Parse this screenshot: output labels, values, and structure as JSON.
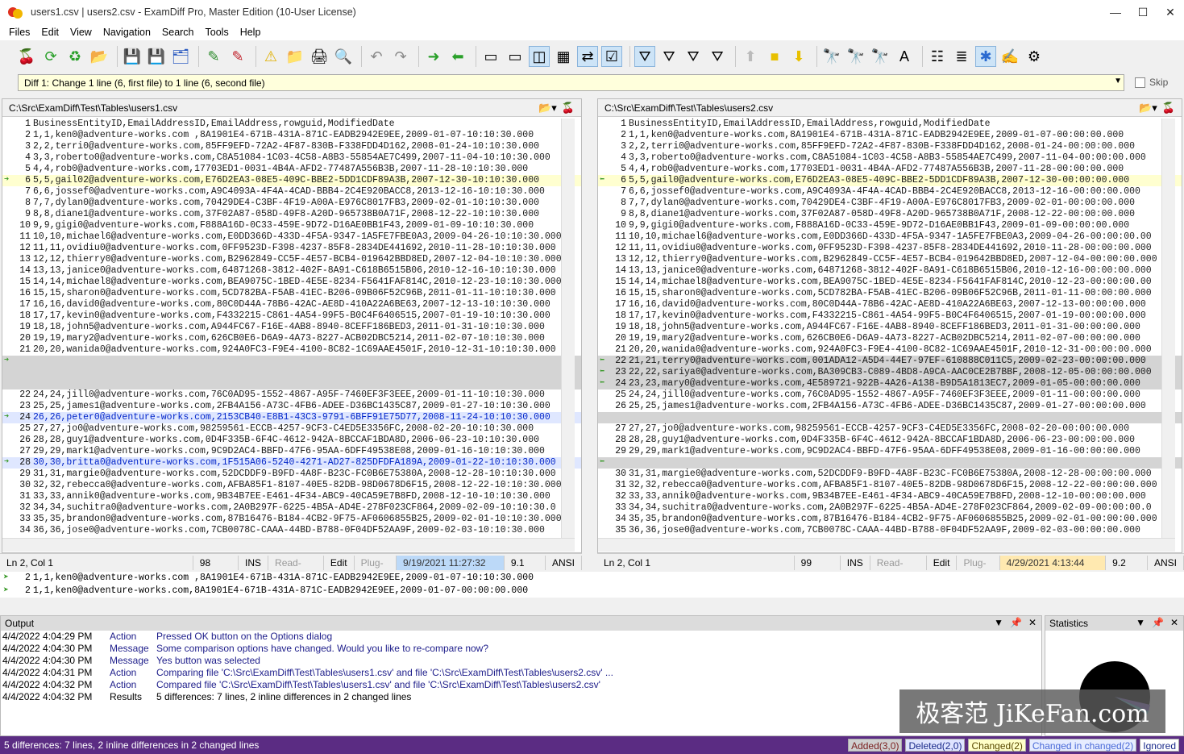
{
  "title": "users1.csv  |  users2.csv - ExamDiff Pro, Master Edition (10-User License)",
  "menu": [
    "Files",
    "Edit",
    "View",
    "Navigation",
    "Search",
    "Tools",
    "Help"
  ],
  "toolbar": [
    "open-icon",
    "refresh-icon",
    "recompare-icon",
    "open-folder-icon",
    "save-icon",
    "save-as-icon",
    "save-all-icon",
    "edit-left-icon",
    "edit-right-icon",
    "warning-icon",
    "folder-warning-icon",
    "print-icon",
    "print-preview-icon",
    "undo-icon",
    "redo-icon",
    "next-diff-icon",
    "prev-diff-icon",
    "single-pane-icon",
    "two-pane-icon",
    "side-by-side-icon",
    "grid-icon",
    "sync-icon",
    "check-icon",
    "filter-icon",
    "filter2-icon",
    "filter3-icon",
    "filter4-icon",
    "up-icon",
    "square-icon",
    "down-icon",
    "find-icon",
    "find-next-icon",
    "find-prev-icon",
    "case-icon",
    "options-icon",
    "lines-icon",
    "plugin-icon",
    "notes-icon",
    "gear-icon"
  ],
  "diff_selector": "Diff 1: Change 1 line (6, first file) to 1 line (6, second file)",
  "skip_label": "Skip",
  "left": {
    "path": "C:\\Src\\ExamDiff\\Test\\Tables\\users1.csv",
    "lines": [
      [
        "1",
        "BusinessEntityID,EmailAddressID,EmailAddress,rowguid,ModifiedDate",
        ""
      ],
      [
        "2",
        "1,1,ken0@adventure-works.com ,8A1901E4-671B-431A-871C-EADB2942E9EE,2009-01-07-10:10:30.000",
        ""
      ],
      [
        "3",
        "2,2,terri0@adventure-works.com,85FF9EFD-72A2-4F87-830B-F338FDD4D162,2008-01-24-10:10:30.000",
        ""
      ],
      [
        "4",
        "3,3,roberto0@adventure-works.com,C8A51084-1C03-4C58-A8B3-55854AE7C499,2007-11-04-10:10:30.000",
        ""
      ],
      [
        "5",
        "4,4,rob0@adventure-works.com,17703ED1-0031-4B4A-AFD2-77487A556B3B,2007-11-28-10:10:30.000",
        ""
      ],
      [
        "6",
        "5,5,gail02@adventure-works.com,E76D2EA3-08E5-409C-BBE2-5DD1CDF89A3B,2007-12-30-10:10:30.000",
        "chg"
      ],
      [
        "7",
        "6,6,jossef0@adventure-works.com,A9C4093A-4F4A-4CAD-BBB4-2C4E920BACC8,2013-12-16-10:10:30.000",
        ""
      ],
      [
        "8",
        "7,7,dylan0@adventure-works.com,70429DE4-C3BF-4F19-A00A-E976C8017FB3,2009-02-01-10:10:30.000",
        ""
      ],
      [
        "9",
        "8,8,diane1@adventure-works.com,37F02A87-058D-49F8-A20D-965738B0A71F,2008-12-22-10:10:30.000",
        ""
      ],
      [
        "10",
        "9,9,gigi0@adventure-works.com,F888A16D-0C33-459E-9D72-D16AE0BB1F43,2009-01-09-10:10:30.000",
        ""
      ],
      [
        "11",
        "10,10,michael6@adventure-works.com,E0DD366D-433D-4F5A-9347-1A5FE7FBE0A3,2009-04-26-10:10:30.000",
        ""
      ],
      [
        "12",
        "11,11,ovidiu0@adventure-works.com,0FF9523D-F398-4237-85F8-2834DE441692,2010-11-28-10:10:30.000",
        ""
      ],
      [
        "13",
        "12,12,thierry0@adventure-works.com,B2962849-CC5F-4E57-BCB4-019642BBD8ED,2007-12-04-10:10:30.000",
        ""
      ],
      [
        "14",
        "13,13,janice0@adventure-works.com,64871268-3812-402F-8A91-C618B6515B06,2010-12-16-10:10:30.000",
        ""
      ],
      [
        "15",
        "14,14,michael8@adventure-works.com,BEA9075C-1BED-4E5E-8234-F5641FAF814C,2010-12-23-10:10:30.000",
        ""
      ],
      [
        "16",
        "15,15,sharon0@adventure-works.com,5CD782BA-F5AB-41EC-B206-09B06F52C96B,2011-01-11-10:10:30.000",
        ""
      ],
      [
        "17",
        "16,16,david0@adventure-works.com,80C0D44A-78B6-42AC-AE8D-410A22A6BE63,2007-12-13-10:10:30.000",
        ""
      ],
      [
        "18",
        "17,17,kevin0@adventure-works.com,F4332215-C861-4A54-99F5-B0C4F6406515,2007-01-19-10:10:30.000",
        ""
      ],
      [
        "19",
        "18,18,john5@adventure-works.com,A944FC67-F16E-4AB8-8940-8CEFF186BED3,2011-01-31-10:10:30.000",
        ""
      ],
      [
        "20",
        "19,19,mary2@adventure-works.com,626CB0E6-D6A9-4A73-8227-ACB02DBC5214,2011-02-07-10:10:30.000",
        ""
      ],
      [
        "21",
        "20,20,wanida0@adventure-works.com,924A0FC3-F9E4-4100-8C82-1C69AAE4501F,2010-12-31-10:10:30.000",
        ""
      ],
      [
        "",
        "",
        "blk"
      ],
      [
        "",
        "",
        "blk"
      ],
      [
        "",
        "",
        "blk"
      ],
      [
        "22",
        "24,24,jill0@adventure-works.com,76C0AD95-1552-4867-A95F-7460EF3F3EEE,2009-01-11-10:10:30.000",
        ""
      ],
      [
        "23",
        "25,25,james1@adventure-works.com,2FB4A156-A73C-4FB6-ADEE-D36BC1435C87,2009-01-27-10:10:30.000",
        ""
      ],
      [
        "24",
        "26,26,peter0@adventure-works.com,2153CB40-E8B1-43C3-9791-6BFF91E75D77,2008-11-24-10:10:30.000",
        "inl"
      ],
      [
        "25",
        "27,27,jo0@adventure-works.com,98259561-ECCB-4257-9CF3-C4ED5E3356FC,2008-02-20-10:10:30.000",
        ""
      ],
      [
        "26",
        "28,28,guy1@adventure-works.com,0D4F335B-6F4C-4612-942A-8BCCAF1BDA8D,2006-06-23-10:10:30.000",
        ""
      ],
      [
        "27",
        "29,29,mark1@adventure-works.com,9C9D2AC4-BBFD-47F6-95AA-6DFF49538E08,2009-01-16-10:10:30.000",
        ""
      ],
      [
        "28",
        "30,30,britta0@adventure-works.com,1F515A06-5240-4271-AD27-825DFDFA189A,2009-01-22-10:10:30.000",
        "inl"
      ],
      [
        "29",
        "31,31,margie0@adventure-works.com,52DCDDF9-B9FD-4A8F-B23C-FC0B6E75380A,2008-12-28-10:10:30.000",
        ""
      ],
      [
        "30",
        "32,32,rebecca0@adventure-works.com,AFBA85F1-8107-40E5-82DB-98D0678D6F15,2008-12-22-10:10:30.000",
        ""
      ],
      [
        "31",
        "33,33,annik0@adventure-works.com,9B34B7EE-E461-4F34-ABC9-40CA59E7B8FD,2008-12-10-10:10:30.000",
        ""
      ],
      [
        "32",
        "34,34,suchitra0@adventure-works.com,2A0B297F-6225-4B5A-AD4E-278F023CF864,2009-02-09-10:10:30.0",
        ""
      ],
      [
        "33",
        "35,35,brandon0@adventure-works.com,87B16476-B184-4CB2-9F75-AF0606855B25,2009-02-01-10:10:30.000",
        ""
      ],
      [
        "34",
        "36,36,jose0@adventure-works.com,7CB0078C-CAAA-44BD-B788-0F04DF52AA9F,2009-02-03-10:10:30.000",
        ""
      ]
    ],
    "status": {
      "pos": "Ln 2, Col 1",
      "lines": "98 lines",
      "ins": "INS",
      "ro": "Read-only",
      "edit": "Edit",
      "plugin": "Plug-in",
      "date": "9/19/2021 11:27:32 AM",
      "size": "9.1 KB",
      "enc": "ANSI"
    }
  },
  "right": {
    "path": "C:\\Src\\ExamDiff\\Test\\Tables\\users2.csv",
    "lines": [
      [
        "1",
        "BusinessEntityID,EmailAddressID,EmailAddress,rowguid,ModifiedDate",
        ""
      ],
      [
        "2",
        "1,1,ken0@adventure-works.com,8A1901E4-671B-431A-871C-EADB2942E9EE,2009-01-07-00:00:00.000",
        ""
      ],
      [
        "3",
        "2,2,terri0@adventure-works.com,85FF9EFD-72A2-4F87-830B-F338FDD4D162,2008-01-24-00:00:00.000",
        ""
      ],
      [
        "4",
        "3,3,roberto0@adventure-works.com,C8A51084-1C03-4C58-A8B3-55854AE7C499,2007-11-04-00:00:00.000",
        ""
      ],
      [
        "5",
        "4,4,rob0@adventure-works.com,17703ED1-0031-4B4A-AFD2-77487A556B3B,2007-11-28-00:00:00.000",
        ""
      ],
      [
        "6",
        "5,5,gail0@adventure-works.com,E76D2EA3-08E5-409C-BBE2-5DD1CDF89A3B,2007-12-30-00:00:00.000",
        "chg"
      ],
      [
        "7",
        "6,6,jossef0@adventure-works.com,A9C4093A-4F4A-4CAD-BBB4-2C4E920BACC8,2013-12-16-00:00:00.000",
        ""
      ],
      [
        "8",
        "7,7,dylan0@adventure-works.com,70429DE4-C3BF-4F19-A00A-E976C8017FB3,2009-02-01-00:00:00.000",
        ""
      ],
      [
        "9",
        "8,8,diane1@adventure-works.com,37F02A87-058D-49F8-A20D-965738B0A71F,2008-12-22-00:00:00.000",
        ""
      ],
      [
        "10",
        "9,9,gigi0@adventure-works.com,F888A16D-0C33-459E-9D72-D16AE0BB1F43,2009-01-09-00:00:00.000",
        ""
      ],
      [
        "11",
        "10,10,michael6@adventure-works.com,E0DD366D-433D-4F5A-9347-1A5FE7FBE0A3,2009-04-26-00:00:00.00",
        ""
      ],
      [
        "12",
        "11,11,ovidiu0@adventure-works.com,0FF9523D-F398-4237-85F8-2834DE441692,2010-11-28-00:00:00.000",
        ""
      ],
      [
        "13",
        "12,12,thierry0@adventure-works.com,B2962849-CC5F-4E57-BCB4-019642BBD8ED,2007-12-04-00:00:00.000",
        ""
      ],
      [
        "14",
        "13,13,janice0@adventure-works.com,64871268-3812-402F-8A91-C618B6515B06,2010-12-16-00:00:00.000",
        ""
      ],
      [
        "15",
        "14,14,michael8@adventure-works.com,BEA9075C-1BED-4E5E-8234-F5641FAF814C,2010-12-23-00:00:00.00",
        ""
      ],
      [
        "16",
        "15,15,sharon0@adventure-works.com,5CD782BA-F5AB-41EC-B206-09B06F52C96B,2011-01-11-00:00:00.000",
        ""
      ],
      [
        "17",
        "16,16,david0@adventure-works.com,80C0D44A-78B6-42AC-AE8D-410A22A6BE63,2007-12-13-00:00:00.000",
        ""
      ],
      [
        "18",
        "17,17,kevin0@adventure-works.com,F4332215-C861-4A54-99F5-B0C4F6406515,2007-01-19-00:00:00.000",
        ""
      ],
      [
        "19",
        "18,18,john5@adventure-works.com,A944FC67-F16E-4AB8-8940-8CEFF186BED3,2011-01-31-00:00:00.000",
        ""
      ],
      [
        "20",
        "19,19,mary2@adventure-works.com,626CB0E6-D6A9-4A73-8227-ACB02DBC5214,2011-02-07-00:00:00.000",
        ""
      ],
      [
        "21",
        "20,20,wanida0@adventure-works.com,924A0FC3-F9E4-4100-8C82-1C69AAE4501F,2010-12-31-00:00:00.000",
        ""
      ],
      [
        "22",
        "21,21,terry0@adventure-works.com,001ADA12-A5D4-44E7-97EF-610888C011C5,2009-02-23-00:00:00.000",
        "ins"
      ],
      [
        "23",
        "22,22,sariya0@adventure-works.com,BA309CB3-C089-4BD8-A9CA-AAC0CE2B7BBF,2008-12-05-00:00:00.000",
        "ins"
      ],
      [
        "24",
        "23,23,mary0@adventure-works.com,4E589721-922B-4A26-A138-B9D5A1813EC7,2009-01-05-00:00:00.000",
        "ins"
      ],
      [
        "25",
        "24,24,jill0@adventure-works.com,76C0AD95-1552-4867-A95F-7460EF3F3EEE,2009-01-11-00:00:00.000",
        ""
      ],
      [
        "26",
        "25,25,james1@adventure-works.com,2FB4A156-A73C-4FB6-ADEE-D36BC1435C87,2009-01-27-00:00:00.000",
        ""
      ],
      [
        "",
        "",
        "blk"
      ],
      [
        "27",
        "27,27,jo0@adventure-works.com,98259561-ECCB-4257-9CF3-C4ED5E3356FC,2008-02-20-00:00:00.000",
        ""
      ],
      [
        "28",
        "28,28,guy1@adventure-works.com,0D4F335B-6F4C-4612-942A-8BCCAF1BDA8D,2006-06-23-00:00:00.000",
        ""
      ],
      [
        "29",
        "29,29,mark1@adventure-works.com,9C9D2AC4-BBFD-47F6-95AA-6DFF49538E08,2009-01-16-00:00:00.000",
        ""
      ],
      [
        "",
        "",
        "blk"
      ],
      [
        "30",
        "31,31,margie0@adventure-works.com,52DCDDF9-B9FD-4A8F-B23C-FC0B6E75380A,2008-12-28-00:00:00.000",
        ""
      ],
      [
        "31",
        "32,32,rebecca0@adventure-works.com,AFBA85F1-8107-40E5-82DB-98D0678D6F15,2008-12-22-00:00:00.000",
        ""
      ],
      [
        "32",
        "33,33,annik0@adventure-works.com,9B34B7EE-E461-4F34-ABC9-40CA59E7B8FD,2008-12-10-00:00:00.000",
        ""
      ],
      [
        "33",
        "34,34,suchitra0@adventure-works.com,2A0B297F-6225-4B5A-AD4E-278F023CF864,2009-02-09-00:00:00.0",
        ""
      ],
      [
        "34",
        "35,35,brandon0@adventure-works.com,87B16476-B184-4CB2-9F75-AF0606855B25,2009-02-01-00:00:00.000",
        ""
      ],
      [
        "35",
        "36,36,jose0@adventure-works.com,7CB0078C-CAAA-44BD-B788-0F04DF52AA9F,2009-02-03-00:00:00.000",
        ""
      ]
    ],
    "status": {
      "pos": "Ln 2, Col 1",
      "lines": "99 lines",
      "ins": "INS",
      "ro": "Read-only",
      "edit": "Edit",
      "plugin": "Plug-in",
      "date": "4/29/2021 4:13:44 PM",
      "size": "9.2 KB",
      "enc": "ANSI"
    }
  },
  "compare": [
    [
      "2",
      "1,1,ken0@adventure-works.com ,8A1901E4-671B-431A-871C-EADB2942E9EE,2009-01-07-10:10:30.000"
    ],
    [
      "2",
      "1,1,ken0@adventure-works.com,8A1901E4-671B-431A-871C-EADB2942E9EE,2009-01-07-00:00:00.000"
    ]
  ],
  "output": {
    "title": "Output",
    "rows": [
      [
        "4/4/2022 4:04:29 PM",
        "Action",
        "Pressed OK button on the Options dialog"
      ],
      [
        "4/4/2022 4:04:30 PM",
        "Message",
        "Some comparison options have changed. Would you like to re-compare now?"
      ],
      [
        "4/4/2022 4:04:30 PM",
        "Message",
        "Yes button was selected"
      ],
      [
        "4/4/2022 4:04:31 PM",
        "Action",
        "Comparing file 'C:\\Src\\ExamDiff\\Test\\Tables\\users1.csv' and file 'C:\\Src\\ExamDiff\\Test\\Tables\\users2.csv' ..."
      ],
      [
        "4/4/2022 4:04:32 PM",
        "Action",
        "Compared file 'C:\\Src\\ExamDiff\\Test\\Tables\\users1.csv' and file 'C:\\Src\\ExamDiff\\Test\\Tables\\users2.csv'"
      ],
      [
        "4/4/2022 4:04:32 PM",
        "Results",
        "5 differences: 7 lines, 2 inline differences in 2 changed lines"
      ]
    ]
  },
  "statistics": {
    "title": "Statistics"
  },
  "statusbar": {
    "text": "5 differences: 7 lines, 2 inline differences in 2 changed lines",
    "badges": [
      {
        "label": "Added(3,0)",
        "bg": "#d0d0d0",
        "fg": "#7a1f1f"
      },
      {
        "label": "Deleted(2,0)",
        "bg": "#dfe4ff",
        "fg": "#1a2a8a"
      },
      {
        "label": "Changed(2)",
        "bg": "#ffffc8",
        "fg": "#5a4a00"
      },
      {
        "label": "Changed in changed(2)",
        "bg": "#e6ecff",
        "fg": "#4a6ad8"
      },
      {
        "label": "Ignored",
        "bg": "#ffffff",
        "fg": "#1a2a8a"
      }
    ]
  },
  "watermark": "极客范 JiKeFan.com"
}
